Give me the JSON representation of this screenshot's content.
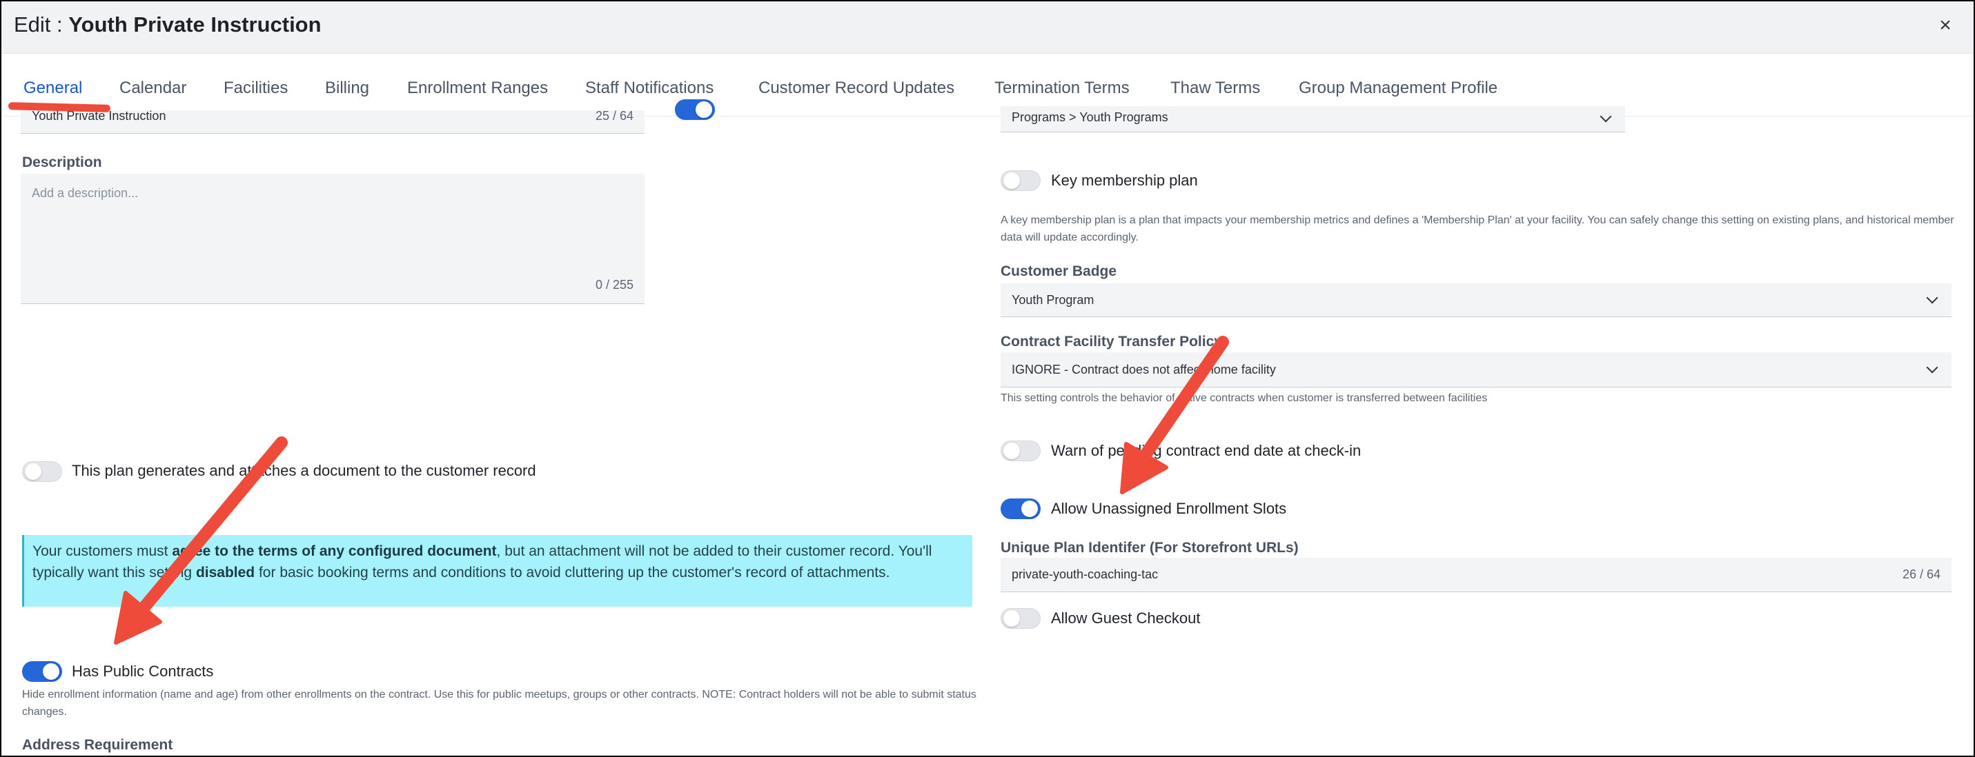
{
  "header": {
    "title_prefix": "Edit : ",
    "title_name": "Youth Private Instruction",
    "close_glyph": "×"
  },
  "tabs": [
    {
      "label": "General",
      "active": true
    },
    {
      "label": "Calendar"
    },
    {
      "label": "Facilities"
    },
    {
      "label": "Billing"
    },
    {
      "label": "Enrollment Ranges"
    },
    {
      "label": "Staff Notifications"
    },
    {
      "label": "Customer Record Updates"
    },
    {
      "label": "Termination Terms"
    },
    {
      "label": "Thaw Terms"
    },
    {
      "label": "Group Management Profile"
    }
  ],
  "left": {
    "name_field": {
      "value": "Youth Private Instruction",
      "counter": "25 / 64"
    },
    "description": {
      "label": "Description",
      "placeholder": "Add a description...",
      "counter": "0 / 255"
    },
    "document_toggle": {
      "label": "This plan generates and attaches a document to the customer record",
      "on": false
    },
    "notice": {
      "part1": "Your customers must ",
      "bold1": "agree to the terms of any configured document",
      "part2": ", but an attachment will not be added to their customer record. You'll typically want this setting ",
      "bold2": "disabled",
      "part3": " for basic booking terms and conditions to avoid cluttering up the customer's record of attachments."
    },
    "public_contracts": {
      "label": "Has Public Contracts",
      "on": true,
      "helper": "Hide enrollment information (name and age) from other enrollments on the contract. Use this for public meetups, groups or other contracts. NOTE: Contract holders will not be able to submit status changes."
    },
    "address_requirement_label": "Address Requirement"
  },
  "right": {
    "category_value": "Programs > Youth Programs",
    "key_membership": {
      "label": "Key membership plan",
      "on": false,
      "helper": "A key membership plan is a plan that impacts your membership metrics and defines a 'Membership Plan' at your facility. You can safely change this setting on existing plans, and historical member data will update accordingly."
    },
    "customer_badge": {
      "label": "Customer Badge",
      "value": "Youth Program"
    },
    "transfer_policy": {
      "label": "Contract Facility Transfer Policy",
      "value": "IGNORE - Contract does not affect home facility",
      "helper": "This setting controls the behavior of active contracts when customer is transferred between facilities"
    },
    "warn_pending": {
      "label": "Warn of pending contract end date at check-in",
      "on": false
    },
    "unassigned_slots": {
      "label": "Allow Unassigned Enrollment Slots",
      "on": true
    },
    "unique_identifier": {
      "label": "Unique Plan Identifer (For Storefront URLs)",
      "value": "private-youth-coaching-tac",
      "counter": "26 / 64"
    },
    "guest_checkout": {
      "label": "Allow Guest Checkout",
      "on": false
    }
  },
  "colors": {
    "accent": "#2566d9",
    "annotation_red": "#ee4b3a",
    "notice_bg": "#a5f2fc"
  }
}
